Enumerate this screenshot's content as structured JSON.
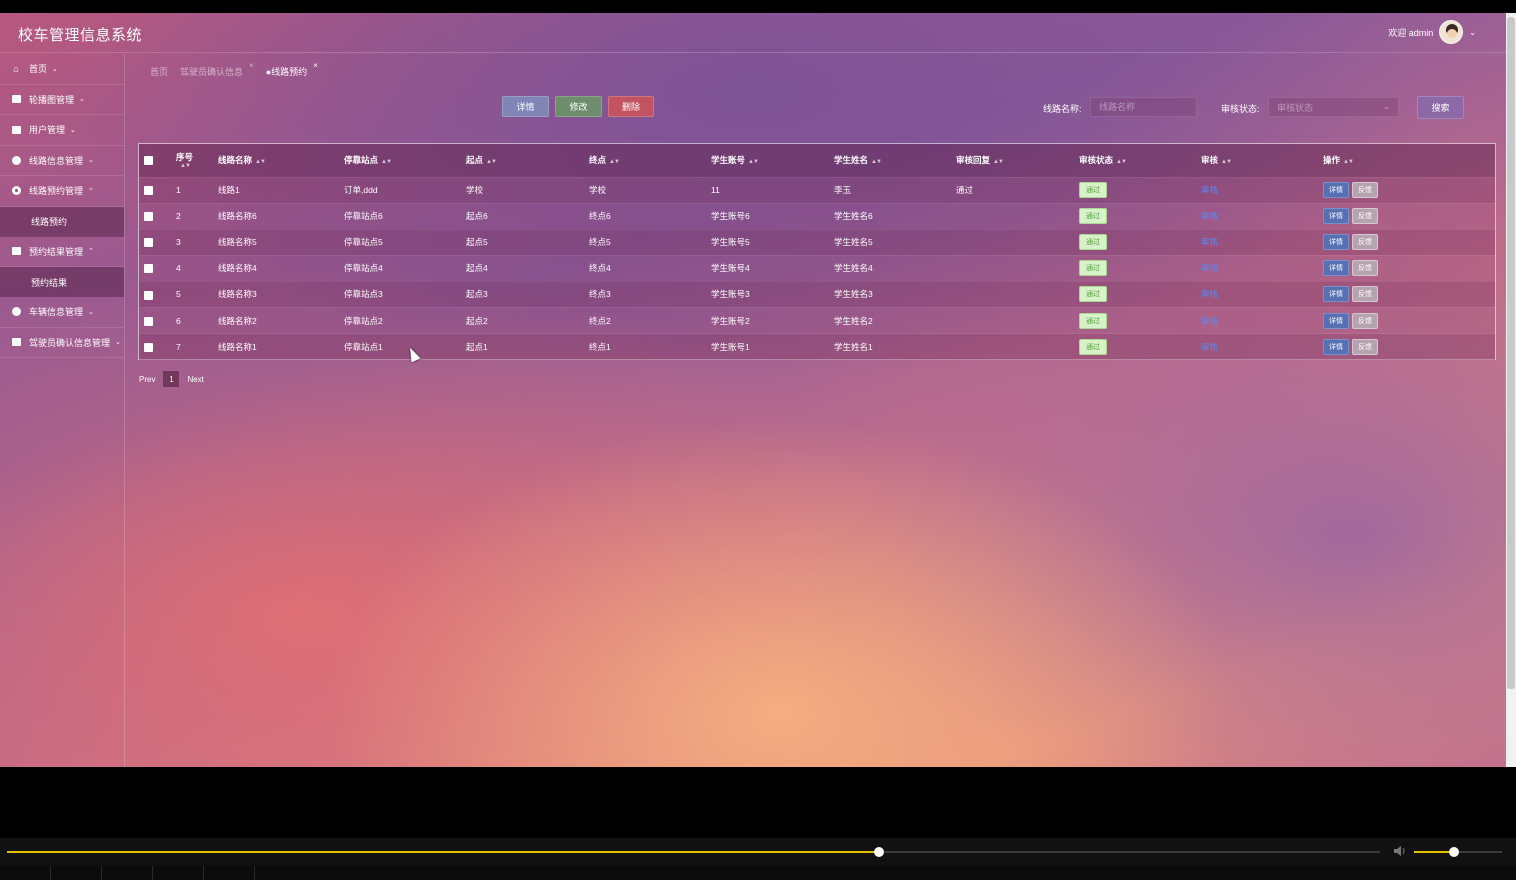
{
  "header": {
    "app_title": "校车管理信息系统",
    "welcome": "欢迎 admin"
  },
  "sidebar": {
    "items": [
      {
        "label": "首页",
        "icon": "home-icon",
        "arrow": "⌄"
      },
      {
        "label": "轮播图管理",
        "icon": "image-icon",
        "arrow": "⌄"
      },
      {
        "label": "用户管理",
        "icon": "user-icon",
        "arrow": "⌄"
      },
      {
        "label": "线路信息管理",
        "icon": "route-icon",
        "arrow": "⌄"
      },
      {
        "label": "线路预约管理",
        "icon": "booking-icon",
        "arrow": "⌃",
        "sub": "线路预约"
      },
      {
        "label": "预约结果管理",
        "icon": "result-icon",
        "arrow": "⌃",
        "sub": "预约结果"
      },
      {
        "label": "车辆信息管理",
        "icon": "bus-icon",
        "arrow": "⌄"
      },
      {
        "label": "驾驶员确认信息管理",
        "icon": "driver-icon",
        "arrow": "⌄"
      }
    ]
  },
  "tabs": [
    {
      "label": "首页"
    },
    {
      "label": "驾驶员确认信息",
      "close": "×"
    },
    {
      "label": "●线路预约",
      "close": "×"
    }
  ],
  "toolbar": {
    "detail": "详情",
    "edit": "修改",
    "delete": "删除",
    "route_label": "线路名称:",
    "route_placeholder": "线路名称",
    "status_label": "审核状态:",
    "status_placeholder": "审核状态",
    "search": "搜索"
  },
  "table": {
    "columns": [
      "序号",
      "线路名称",
      "停靠站点",
      "起点",
      "终点",
      "学生账号",
      "学生姓名",
      "审核回复",
      "审核状态",
      "审核",
      "操作"
    ],
    "rows": [
      {
        "no": "1",
        "name": "线路1",
        "stop": "订单,ddd",
        "start": "学校",
        "end": "学校",
        "account": "11",
        "student": "李玉",
        "reply": "通过",
        "status": "通过",
        "audit": "审核",
        "op1": "详情",
        "op2": "反馈"
      },
      {
        "no": "2",
        "name": "线路名称6",
        "stop": "停靠站点6",
        "start": "起点6",
        "end": "终点6",
        "account": "学生账号6",
        "student": "学生姓名6",
        "reply": "",
        "status": "通过",
        "audit": "审核",
        "op1": "详情",
        "op2": "反馈"
      },
      {
        "no": "3",
        "name": "线路名称5",
        "stop": "停靠站点5",
        "start": "起点5",
        "end": "终点5",
        "account": "学生账号5",
        "student": "学生姓名5",
        "reply": "",
        "status": "通过",
        "audit": "审核",
        "op1": "详情",
        "op2": "反馈"
      },
      {
        "no": "4",
        "name": "线路名称4",
        "stop": "停靠站点4",
        "start": "起点4",
        "end": "终点4",
        "account": "学生账号4",
        "student": "学生姓名4",
        "reply": "",
        "status": "通过",
        "audit": "审核",
        "op1": "详情",
        "op2": "反馈"
      },
      {
        "no": "5",
        "name": "线路名称3",
        "stop": "停靠站点3",
        "start": "起点3",
        "end": "终点3",
        "account": "学生账号3",
        "student": "学生姓名3",
        "reply": "",
        "status": "通过",
        "audit": "审核",
        "op1": "详情",
        "op2": "反馈"
      },
      {
        "no": "6",
        "name": "线路名称2",
        "stop": "停靠站点2",
        "start": "起点2",
        "end": "终点2",
        "account": "学生账号2",
        "student": "学生姓名2",
        "reply": "",
        "status": "通过",
        "audit": "审核",
        "op1": "详情",
        "op2": "反馈"
      },
      {
        "no": "7",
        "name": "线路名称1",
        "stop": "停靠站点1",
        "start": "起点1",
        "end": "终点1",
        "account": "学生账号1",
        "student": "学生姓名1",
        "reply": "",
        "status": "通过",
        "audit": "审核",
        "op1": "详情",
        "op2": "反馈"
      }
    ]
  },
  "pagination": {
    "prev": "Prev",
    "current": "1",
    "next": "Next"
  },
  "player": {
    "progress": 0.635,
    "volume": 0.45
  },
  "colors": {
    "accent_yellow": "#e5c200",
    "badge_green": "#56a23c",
    "link_blue": "#4f8eff",
    "delete_red": "#c25461"
  }
}
